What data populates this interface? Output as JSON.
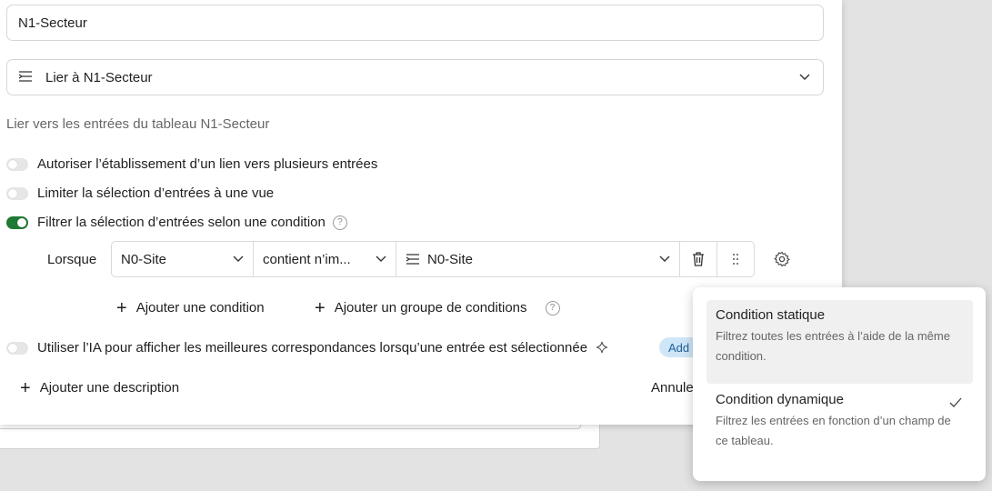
{
  "name_field": {
    "value": "N1-Secteur"
  },
  "link_field": {
    "label": "Lier à N1-Secteur"
  },
  "hint": "Lier vers les entrées du tableau N1-Secteur",
  "toggles": [
    {
      "label": "Autoriser l’établissement d’un lien vers plusieurs entrées",
      "on": false
    },
    {
      "label": "Limiter la sélection d’entrées à une vue",
      "on": false
    },
    {
      "label": "Filtrer la sélection d’entrées selon une condition",
      "on": true
    }
  ],
  "condition": {
    "when_label": "Lorsque",
    "field": "N0-Site",
    "operator": "contient n’im...",
    "value": "N0-Site"
  },
  "add_condition": "Ajouter une condition",
  "add_group": "Ajouter un groupe de conditions",
  "ai_toggle": {
    "label": "Utiliser l’IA pour afficher les meilleures correspondances lorsqu’une entrée est sélectionnée",
    "on": false
  },
  "ai_pill": "Add",
  "add_description": "Ajouter une description",
  "cancel": "Annule",
  "popup": {
    "options": [
      {
        "title": "Condition statique",
        "desc_line1": "Filtrez toutes les entrées à l’aide de la même",
        "desc_line2": "condition."
      },
      {
        "title": "Condition dynamique",
        "desc_line1": "Filtrez les entrées en fonction d’un champ de",
        "desc_line2": "ce tableau.",
        "checked": true
      }
    ]
  },
  "colors": {
    "toggle_on": "#1f7a35",
    "popup_highlight": "#f0f0f0",
    "pill_bg": "#cfe6f7"
  }
}
